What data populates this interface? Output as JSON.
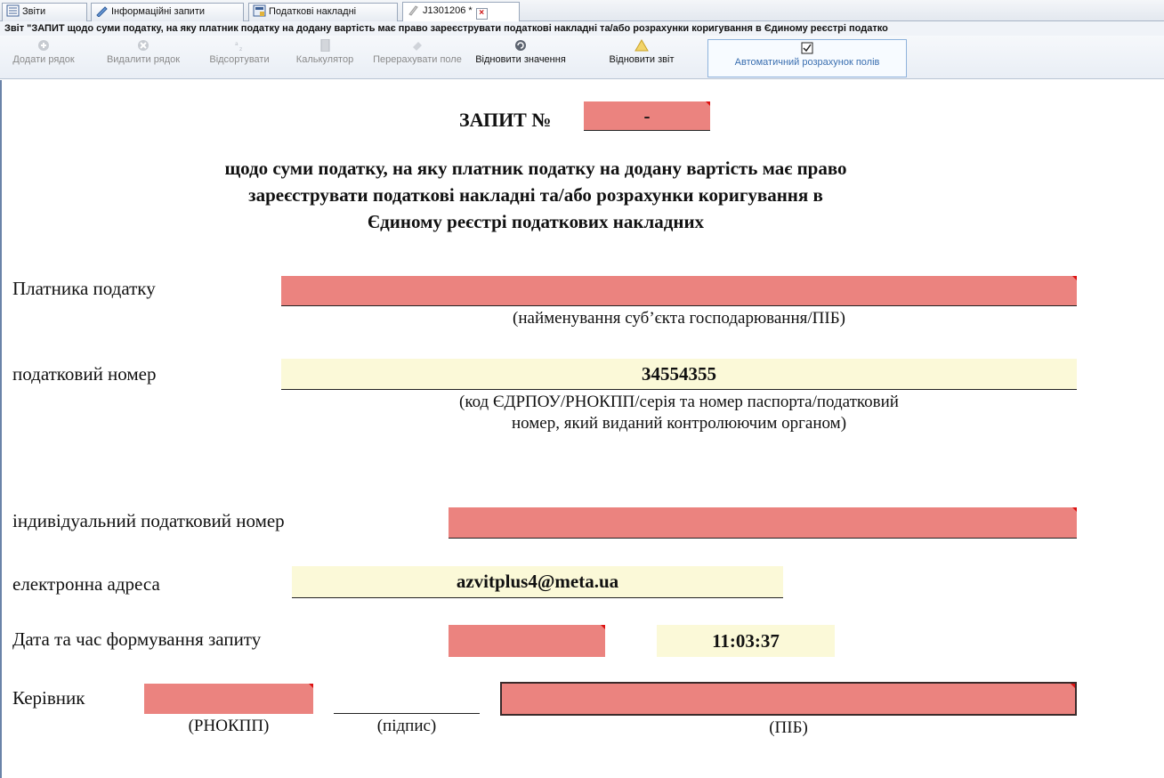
{
  "tabs": [
    {
      "label": "Звіти"
    },
    {
      "label": "Інформаційні запити"
    },
    {
      "label": "Податкові накладні"
    },
    {
      "label": "J1301206 *"
    }
  ],
  "doc_title": "Звіт \"ЗАПИТ щодо суми податку, на яку платник податку на додану вартість має право зареєструвати податкові накладні та/або розрахунки коригування в Єдиному реєстрі податко",
  "toolbar": {
    "add_row": "Додати рядок",
    "delete_row": "Видалити рядок",
    "sort": "Відсортувати",
    "calculator": "Калькулятор",
    "recalc_field": "Перерахувати поле",
    "restore_value": "Відновити значення",
    "restore_report": "Відновити звіт",
    "auto_calc": "Автоматичний розрахунок полів"
  },
  "form": {
    "heading": "ЗАПИТ №",
    "number_value": "-",
    "subtitle_line1": "щодо суми податку, на яку платник податку на додану вартість має право",
    "subtitle_line2": "зареєструвати податкові накладні та/або розрахунки коригування в",
    "subtitle_line3": "Єдиному реєстрі податкових накладних",
    "payer_label": "Платника податку",
    "payer_value": "",
    "payer_hint": "(найменування суб’єкта господарювання/ПІБ)",
    "tax_number_label": "податковий номер",
    "tax_number_value": "34554355",
    "tax_number_hint_line1": "(код ЄДРПОУ/РНОКПП/серія та номер паспорта/податковий",
    "tax_number_hint_line2": "номер, який виданий контролюючим органом)",
    "ipn_label": "індивідуальний податковий номер",
    "ipn_value": "",
    "email_label": "електронна адреса",
    "email_value": "azvitplus4@meta.ua",
    "datetime_label": "Дата та час формування запиту",
    "date_value": "",
    "time_value": "11:03:37",
    "director_label": "Керівник",
    "director_rnokpp_value": "",
    "director_rnokpp_hint": "(РНОКПП)",
    "signature_hint": "(підпис)",
    "director_name_value": "",
    "director_name_hint": "(ПІБ)"
  }
}
